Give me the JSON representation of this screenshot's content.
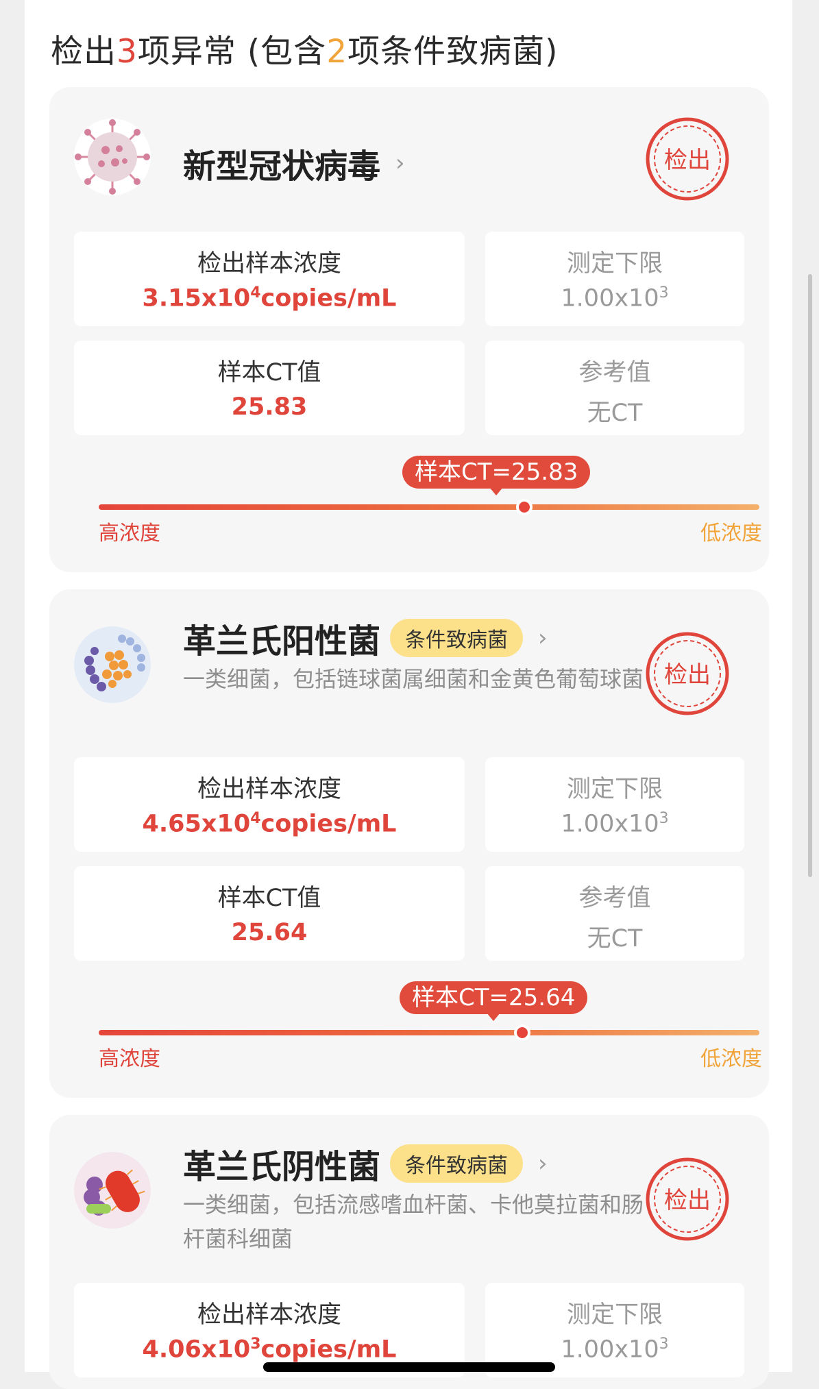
{
  "summary": {
    "prefix": "检出",
    "abnormal_count": "3",
    "mid": "项异常 (包含",
    "conditional_count": "2",
    "suffix": "项条件致病菌)"
  },
  "colors": {
    "accent_red": "#e0453c",
    "accent_orange": "#f0a43a",
    "tag_yellow": "#fce08a",
    "card_bg": "#f6f6f6"
  },
  "stamp_text": "检出",
  "items": [
    {
      "name": "新型冠状病毒",
      "icon": "coronavirus-icon",
      "tag": "",
      "description": "",
      "concentration_label": "检出样本浓度",
      "concentration_mantissa": "3.15",
      "concentration_base": "x10",
      "concentration_exp": "4",
      "concentration_unit": "copies/mL",
      "limit_label": "测定下限",
      "limit_base": "1.00x10",
      "limit_exp": "3",
      "ct_label": "样本CT值",
      "ct_value": "25.83",
      "ref_label": "参考值",
      "ref_value": "无CT",
      "marker_label": "样本CT=25.83",
      "high_label": "高浓度",
      "low_label": "低浓度"
    },
    {
      "name": "革兰氏阳性菌",
      "icon": "gram-positive-bacteria-icon",
      "tag": "条件致病菌",
      "description": "一类细菌，包括链球菌属细菌和金黄色葡萄球菌",
      "concentration_label": "检出样本浓度",
      "concentration_mantissa": "4.65",
      "concentration_base": "x10",
      "concentration_exp": "4",
      "concentration_unit": "copies/mL",
      "limit_label": "测定下限",
      "limit_base": "1.00x10",
      "limit_exp": "3",
      "ct_label": "样本CT值",
      "ct_value": "25.64",
      "ref_label": "参考值",
      "ref_value": "无CT",
      "marker_label": "样本CT=25.64",
      "high_label": "高浓度",
      "low_label": "低浓度"
    },
    {
      "name": "革兰氏阴性菌",
      "icon": "gram-negative-bacteria-icon",
      "tag": "条件致病菌",
      "description": "一类细菌，包括流感嗜血杆菌、卡他莫拉菌和肠杆菌科细菌",
      "concentration_label": "检出样本浓度",
      "concentration_mantissa": "4.06",
      "concentration_base": "x10",
      "concentration_exp": "3",
      "concentration_unit": "copies/mL",
      "limit_label": "测定下限",
      "limit_base": "1.00x10",
      "limit_exp": "3"
    }
  ]
}
